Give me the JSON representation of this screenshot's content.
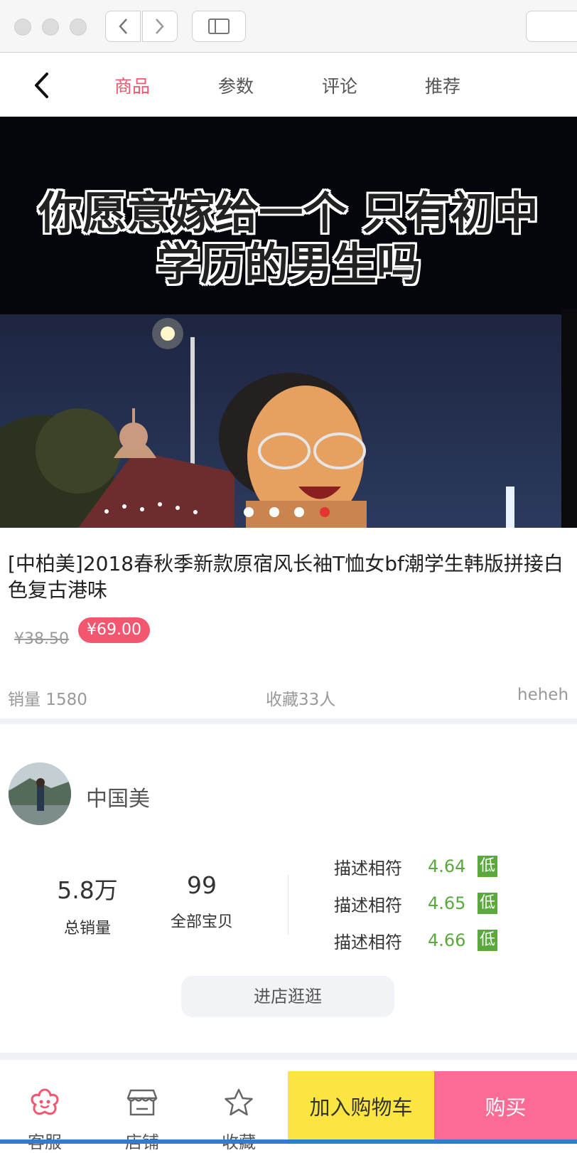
{
  "tabs": [
    {
      "label": "商品",
      "active": true
    },
    {
      "label": "参数",
      "active": false
    },
    {
      "label": "评论",
      "active": false
    },
    {
      "label": "推荐",
      "active": false
    }
  ],
  "hero": {
    "caption_line1": "你愿意嫁给一个 只有初中",
    "caption_line2": "学历的男生吗",
    "slide_count": 4,
    "active_slide": 4
  },
  "product": {
    "title": "[中柏美]2018春秋季新款原宿风长袖T恤女bf潮学生韩版拼接白色复古港味",
    "old_price": "¥38.50",
    "price": "¥69.00",
    "sales": "销量 1580",
    "favorites": "收藏33人",
    "location": "heheh"
  },
  "shop": {
    "name": "中国美",
    "total_sales": {
      "value": "5.8万",
      "label": "总销量"
    },
    "all_items": {
      "value": "99",
      "label": "全部宝贝"
    },
    "ratings": [
      {
        "label": "描述相符",
        "value": "4.64",
        "badge": "低"
      },
      {
        "label": "描述相符",
        "value": "4.65",
        "badge": "低"
      },
      {
        "label": "描述相符",
        "value": "4.66",
        "badge": "低"
      }
    ],
    "enter_label": "进店逛逛"
  },
  "bottom_bar": {
    "service": "客服",
    "store": "店铺",
    "favorite": "收藏",
    "add_to_cart": "加入购物车",
    "buy": "购买"
  },
  "colors": {
    "accent": "#f2576f",
    "rating_green": "#5aa83e",
    "cart_yellow": "#fde541",
    "buy_pink": "#fc6b95",
    "dot_active": "#e4352f"
  }
}
